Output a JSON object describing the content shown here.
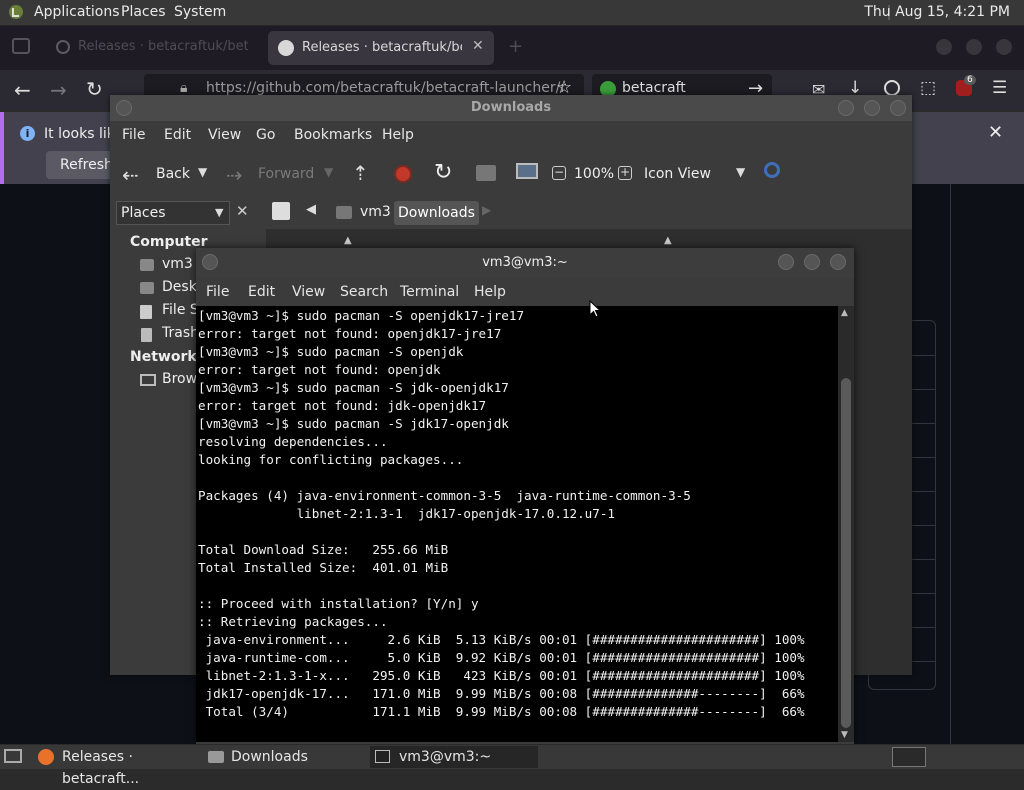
{
  "top_panel": {
    "applications": "Applications",
    "places": "Places",
    "system": "System",
    "clock": "Thu Aug 15,  4:21 PM"
  },
  "firefox": {
    "tab1_title": "Releases · betacraftuk/betacraft-launcher",
    "tab2_title": "Releases · betacraftuk/betac",
    "url": "https://github.com/betacraftuk/betacraft-launcher/releases",
    "search_text": "betacraft",
    "notice_text": "It looks like",
    "refresh_label": "Refresh",
    "badge_count": "6"
  },
  "downloads": {
    "title": "Downloads",
    "menu": [
      "File",
      "Edit",
      "View",
      "Go",
      "Bookmarks",
      "Help"
    ],
    "toolbar": {
      "back": "Back",
      "forward": "Forward",
      "zoom": "100%",
      "view_mode": "Icon View"
    },
    "places_select": "Places",
    "breadcrumb": [
      "vm3",
      "Downloads"
    ],
    "sidebar": {
      "computer_header": "Computer",
      "computer_items": [
        "vm3",
        "Deskt",
        "File S",
        "Trash"
      ],
      "network_header": "Network",
      "network_items": [
        "Brows"
      ]
    }
  },
  "terminal": {
    "title": "vm3@vm3:~",
    "menu": [
      "File",
      "Edit",
      "View",
      "Search",
      "Terminal",
      "Help"
    ],
    "lines": [
      "[vm3@vm3 ~]$ sudo pacman -S openjdk17-jre17",
      "error: target not found: openjdk17-jre17",
      "[vm3@vm3 ~]$ sudo pacman -S openjdk",
      "error: target not found: openjdk",
      "[vm3@vm3 ~]$ sudo pacman -S jdk-openjdk17",
      "error: target not found: jdk-openjdk17",
      "[vm3@vm3 ~]$ sudo pacman -S jdk17-openjdk",
      "resolving dependencies...",
      "looking for conflicting packages...",
      "",
      "Packages (4) java-environment-common-3-5  java-runtime-common-3-5",
      "             libnet-2:1.3-1  jdk17-openjdk-17.0.12.u7-1",
      "",
      "Total Download Size:   255.66 MiB",
      "Total Installed Size:  401.01 MiB",
      "",
      ":: Proceed with installation? [Y/n] y",
      ":: Retrieving packages...",
      " java-environment...     2.6 KiB  5.13 KiB/s 00:01 [######################] 100%",
      " java-runtime-com...     5.0 KiB  9.92 KiB/s 00:01 [######################] 100%",
      " libnet-2:1.3-1-x...   295.0 KiB   423 KiB/s 00:01 [######################] 100%",
      " jdk17-openjdk-17...   171.0 MiB  9.99 MiB/s 00:08 [##############--------]  66%",
      " Total (3/4)           171.1 MiB  9.99 MiB/s 00:08 [##############--------]  66%"
    ]
  },
  "taskbar": {
    "items": [
      "Releases · betacraft...",
      "Downloads",
      "vm3@vm3:~"
    ]
  },
  "colors": {
    "panel": "#383838",
    "terminal_bg": "#000000",
    "firefox_notice_accent": "#b16ef0",
    "record_red": "#c0392b"
  }
}
